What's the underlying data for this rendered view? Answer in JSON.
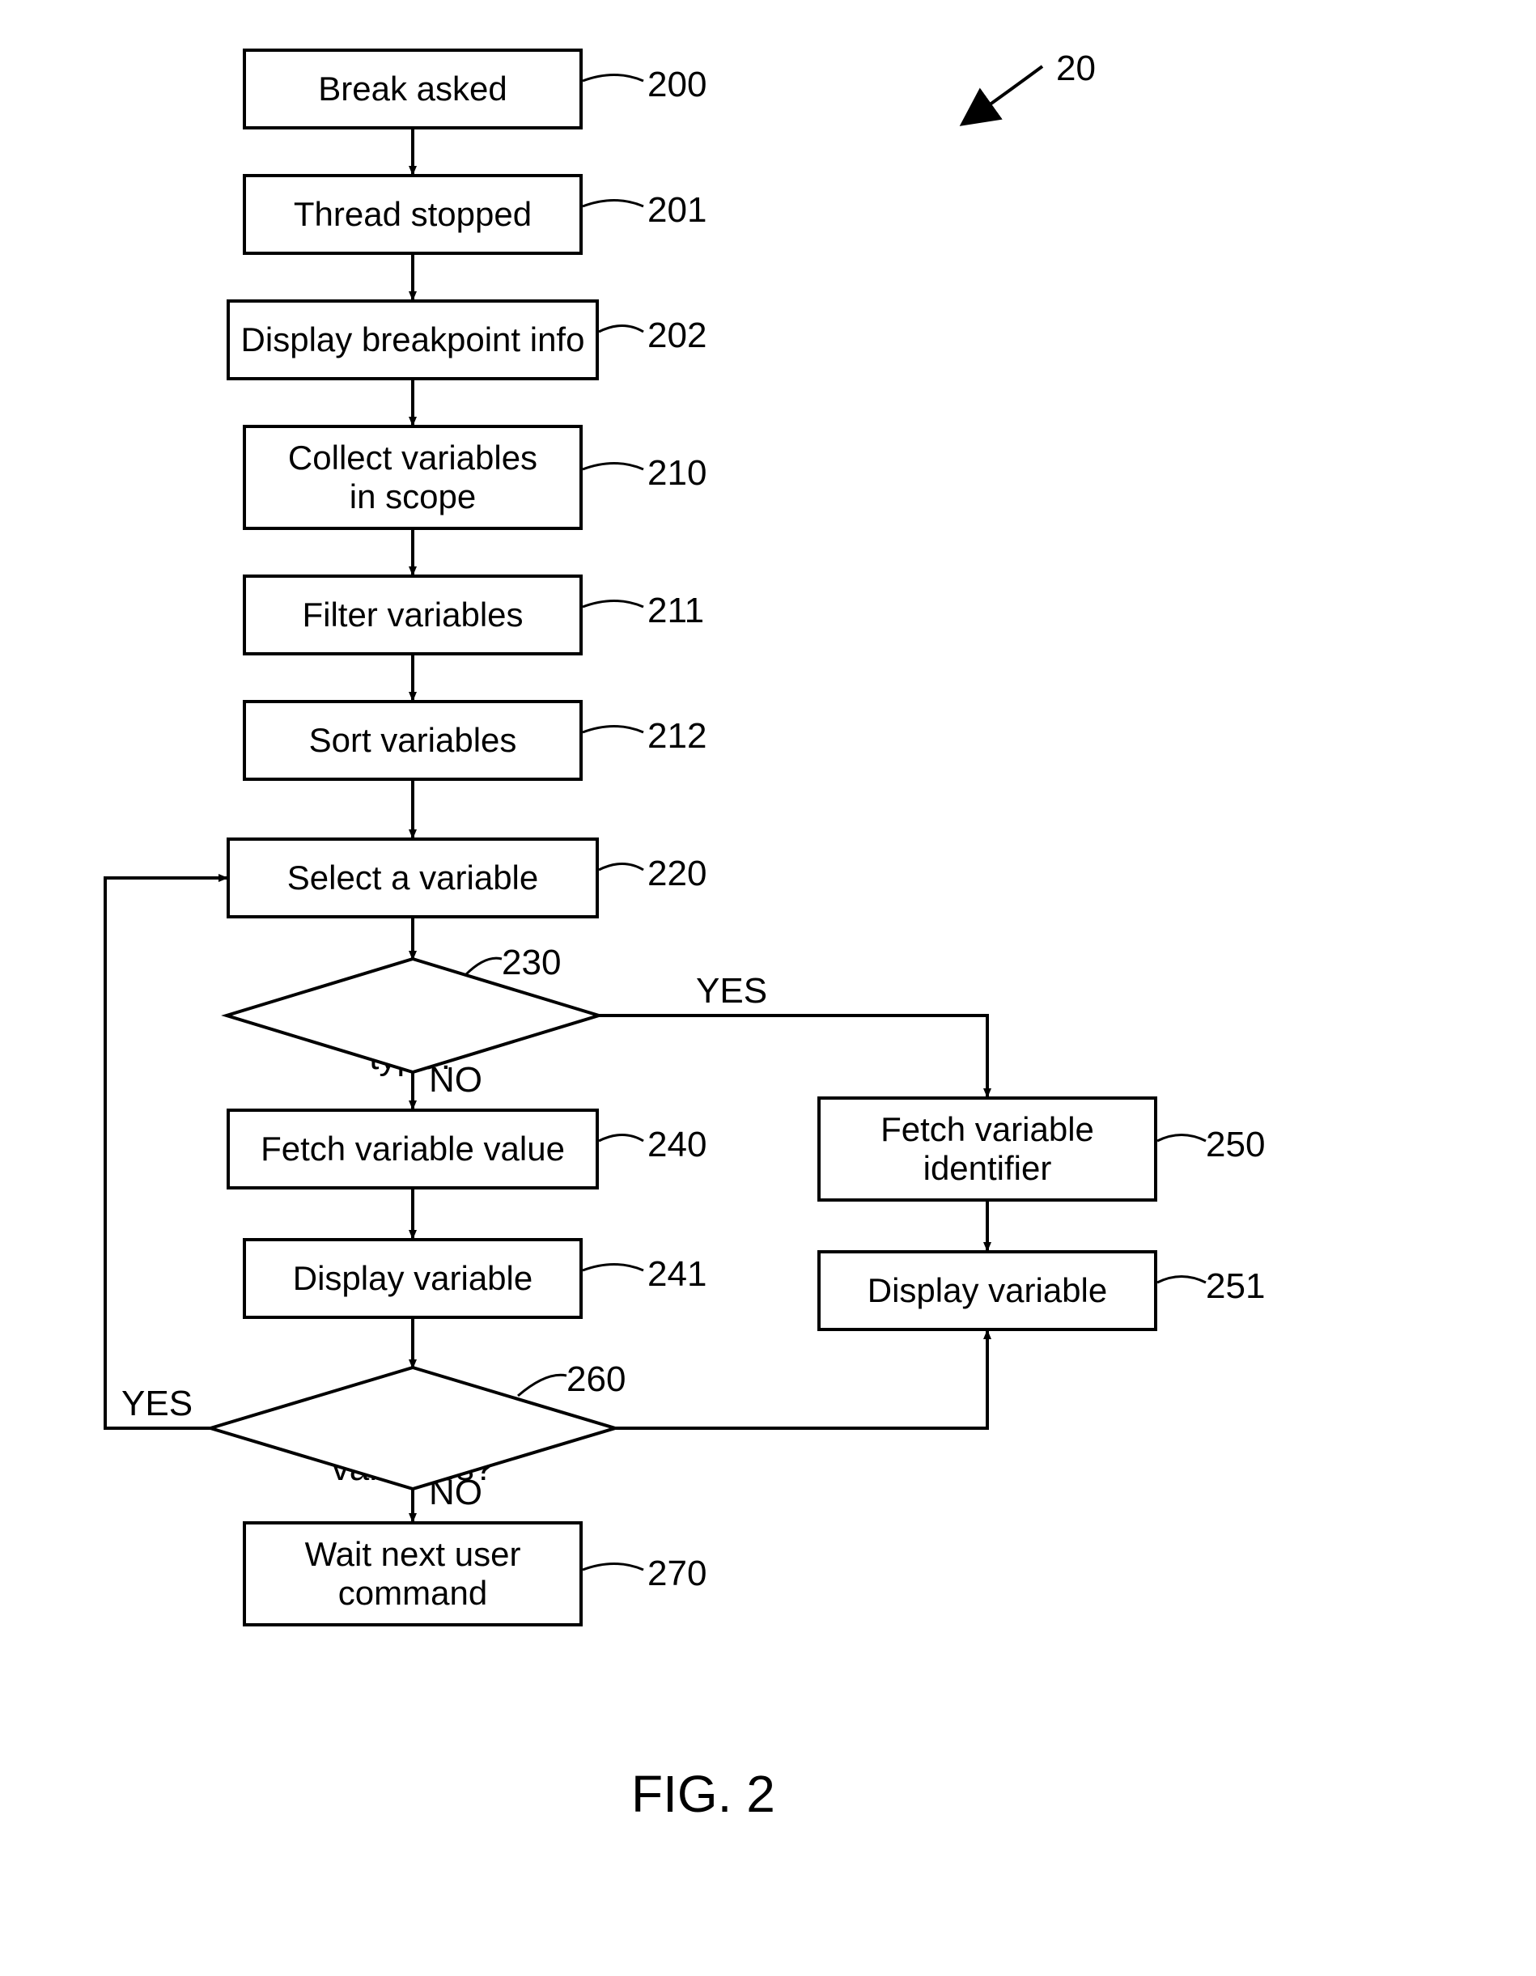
{
  "figure": {
    "caption": "FIG. 2",
    "topref": "20"
  },
  "nodes": {
    "n200": {
      "text": "Break asked",
      "ref": "200"
    },
    "n201": {
      "text": "Thread stopped",
      "ref": "201"
    },
    "n202": {
      "text": "Display breakpoint info",
      "ref": "202"
    },
    "n210": {
      "text": "Collect variables\nin scope",
      "ref": "210"
    },
    "n211": {
      "text": "Filter variables",
      "ref": "211"
    },
    "n212": {
      "text": "Sort variables",
      "ref": "212"
    },
    "n220": {
      "text": "Select a variable",
      "ref": "220"
    },
    "n230": {
      "text": "Complex type?",
      "ref": "230"
    },
    "n240": {
      "text": "Fetch variable value",
      "ref": "240"
    },
    "n241": {
      "text": "Display variable",
      "ref": "241"
    },
    "n250": {
      "text": "Fetch variable\nidentifier",
      "ref": "250"
    },
    "n251": {
      "text": "Display variable",
      "ref": "251"
    },
    "n260": {
      "text": "More variables?",
      "ref": "260"
    },
    "n270": {
      "text": "Wait next user\ncommand",
      "ref": "270"
    }
  },
  "branches": {
    "d230_yes": "YES",
    "d230_no": "NO",
    "d260_yes": "YES",
    "d260_no": "NO"
  }
}
